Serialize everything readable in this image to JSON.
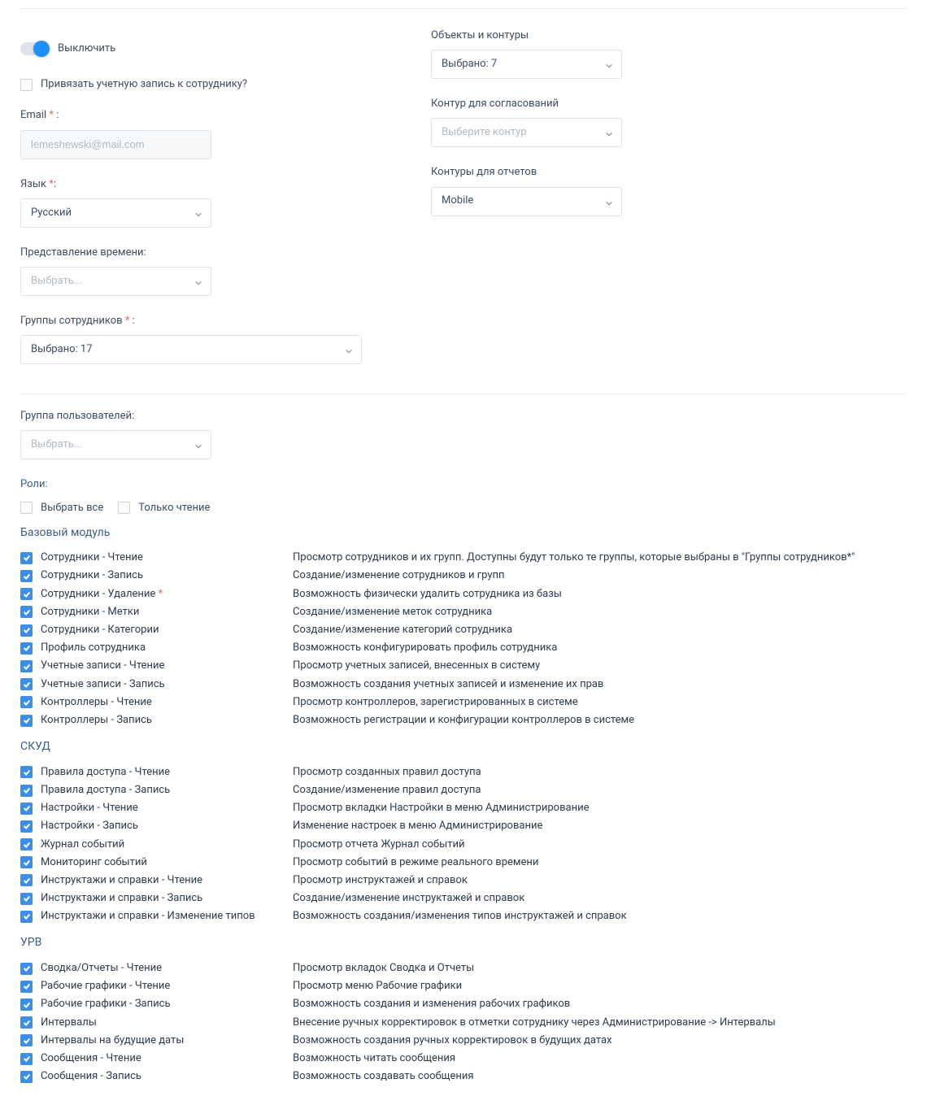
{
  "toggle": {
    "label": "Выключить"
  },
  "linkEmployee": {
    "label": "Привязать учетную запись к сотруднику?"
  },
  "email": {
    "label": "Email",
    "required": "*",
    "placeholder": "lemeshewski@mail.com"
  },
  "language": {
    "label": "Язык",
    "required": "*",
    "value": "Русский"
  },
  "timeRepr": {
    "label": "Представление времени:",
    "placeholder": "Выбрать..."
  },
  "empGroups": {
    "label": "Группы сотрудников",
    "required": "*",
    "value": "Выбрано: 17"
  },
  "userGroup": {
    "label": "Группа пользователей:",
    "placeholder": "Выбрать..."
  },
  "objectsContours": {
    "label": "Объекты и контуры",
    "value": "Выбрано: 7"
  },
  "approvalContour": {
    "label": "Контур для согласований",
    "placeholder": "Выберите контур"
  },
  "reportContours": {
    "label": "Контуры для отчетов",
    "value": "Mobile"
  },
  "roles": {
    "heading": "Роли:",
    "selectAll": "Выбрать все",
    "readOnly": "Только чтение",
    "modules": [
      {
        "title": "Базовый модуль",
        "items": [
          {
            "name": "Сотрудники - Чтение",
            "desc": "Просмотр сотрудников и их групп. Доступны будут только те группы, которые выбраны в \"Группы сотрудников*\""
          },
          {
            "name": "Сотрудники - Запись",
            "desc": "Создание/изменение сотрудников и групп"
          },
          {
            "name": "Сотрудники - Удаление",
            "star": " *",
            "desc": "Возможность физически удалить сотрудника из базы"
          },
          {
            "name": "Сотрудники - Метки",
            "desc": "Создание/изменение меток сотрудника"
          },
          {
            "name": "Сотрудники - Категории",
            "desc": "Создание/изменение категорий сотрудника"
          },
          {
            "name": "Профиль сотрудника",
            "desc": "Возможность конфигурировать профиль сотрудника"
          },
          {
            "name": "Учетные записи - Чтение",
            "desc": "Просмотр учетных записей, внесенных в систему"
          },
          {
            "name": "Учетные записи - Запись",
            "desc": "Возможность создания учетных записей и изменение их прав"
          },
          {
            "name": "Контроллеры - Чтение",
            "desc": "Просмотр контроллеров, зарегистрированных в системе"
          },
          {
            "name": "Контроллеры - Запись",
            "desc": "Возможность регистрации и конфигурации контроллеров в системе"
          }
        ]
      },
      {
        "title": "СКУД",
        "items": [
          {
            "name": "Правила доступа - Чтение",
            "desc": "Просмотр созданных правил доступа"
          },
          {
            "name": "Правила доступа - Запись",
            "desc": "Создание/изменение правил доступа"
          },
          {
            "name": "Настройки - Чтение",
            "desc": "Просмотр вкладки Настройки в меню Администрирование"
          },
          {
            "name": "Настройки - Запись",
            "desc": "Изменение настроек в меню Администрирование"
          },
          {
            "name": "Журнал событий",
            "desc": "Просмотр отчета Журнал событий"
          },
          {
            "name": "Мониторинг событий",
            "desc": "Просмотр событий в режиме реального времени"
          },
          {
            "name": "Инструктажи и справки - Чтение",
            "desc": "Просмотр инструктажей и справок"
          },
          {
            "name": "Инструктажи и справки - Запись",
            "desc": "Создание/изменение инструктажей и справок"
          },
          {
            "name": "Инструктажи и справки - Изменение типов",
            "desc": "Возможность создания/изменения типов инструктажей и справок"
          }
        ]
      },
      {
        "title": "УРВ",
        "items": [
          {
            "name": "Сводка/Отчеты - Чтение",
            "desc": "Просмотр вкладок Сводка и Отчеты"
          },
          {
            "name": "Рабочие графики - Чтение",
            "desc": "Просмотр меню Рабочие графики"
          },
          {
            "name": "Рабочие графики - Запись",
            "desc": "Возможность создания и изменения рабочих графиков"
          },
          {
            "name": "Интервалы",
            "desc": "Внесение ручных корректировок в отметки сотруднику через Администрирование -> Интервалы"
          },
          {
            "name": "Интервалы на будущие даты",
            "desc": "Возможность создания ручных корректировок в будущих датах"
          },
          {
            "name": "Сообщения - Чтение",
            "desc": "Возможность читать сообщения"
          },
          {
            "name": "Сообщения - Запись",
            "desc": "Возможность создавать сообщения"
          }
        ]
      }
    ]
  }
}
